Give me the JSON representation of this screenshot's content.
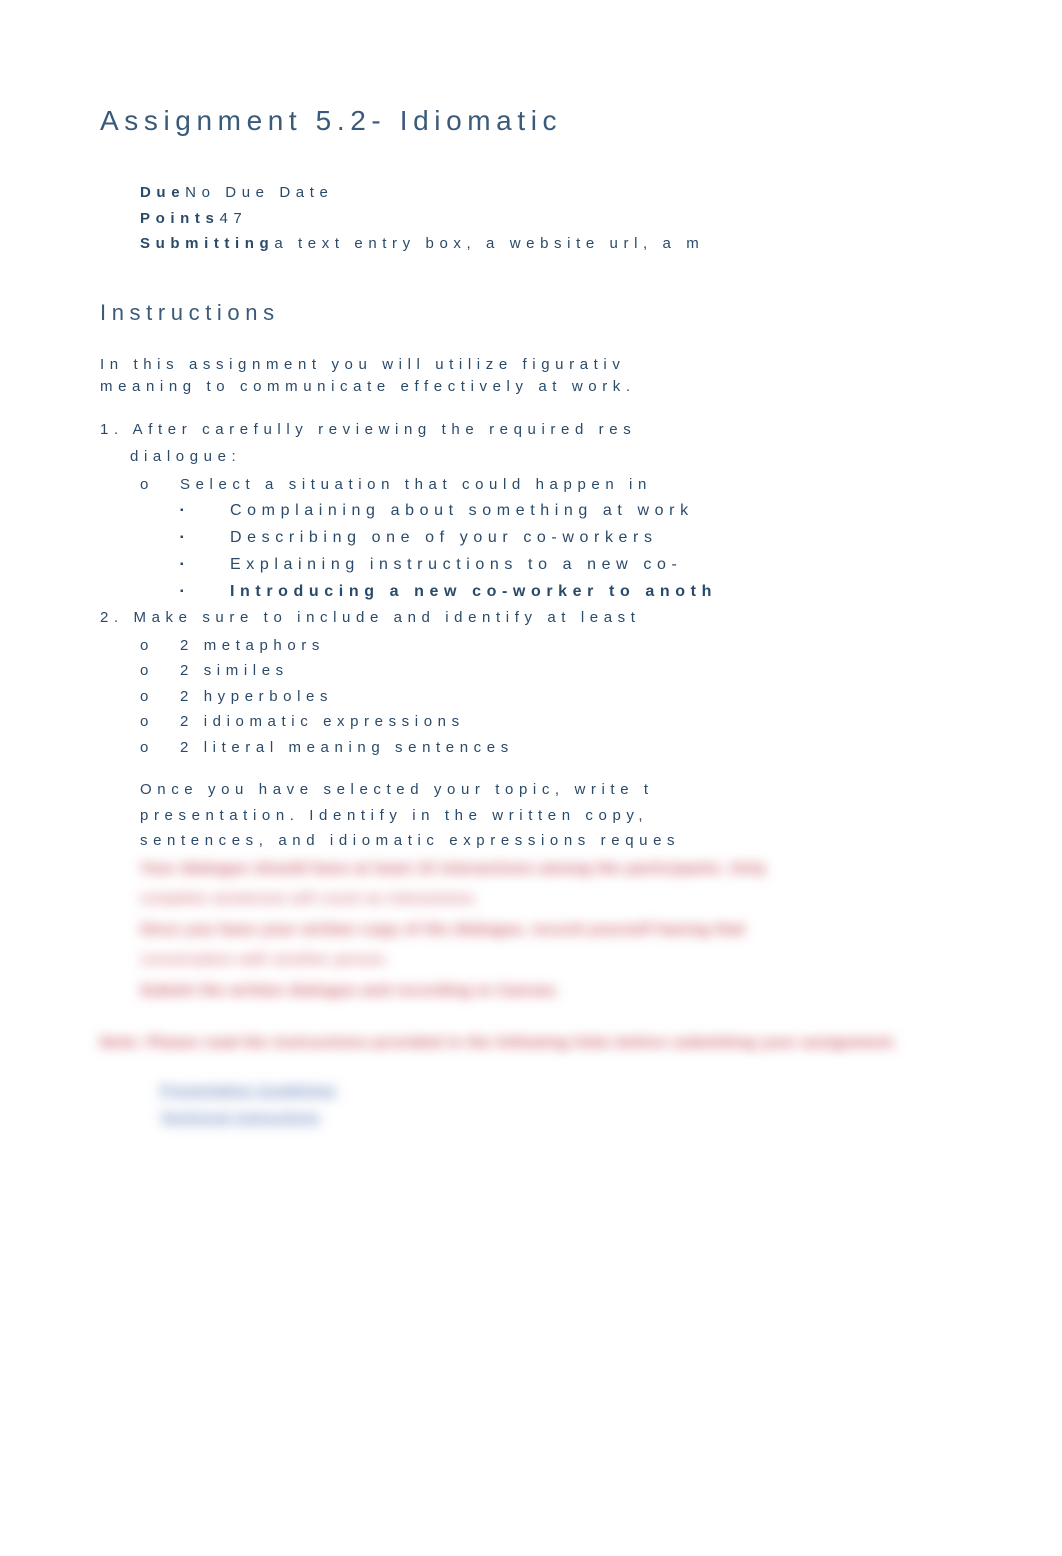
{
  "title": "Assignment 5.2- Idiomatic",
  "meta": {
    "due_label": "Due",
    "due_value": "No Due Date",
    "points_label": "Points",
    "points_value": "47",
    "submit_label": "Submitting",
    "submit_value": "a text entry box, a website url, a m"
  },
  "instructions_heading": "Instructions",
  "intro_line1": "In this assignment you will utilize figurativ",
  "intro_line2": "meaning to communicate effectively at work.",
  "step1": "1. After carefully reviewing the required res",
  "step1_sub": "dialogue:",
  "step1_o": "Select a situation that could happen in",
  "situations": [
    "Complaining about something at work",
    "Describing one of your co-workers",
    "Explaining instructions to a new co-"
  ],
  "situation_bold": "Introducing a new co-worker to anoth",
  "step2": "2. Make sure to include and identify at least",
  "requirements": [
    "2 metaphors",
    "2 similes",
    "2 hyperboles",
    "2 idiomatic expressions",
    "2 literal meaning sentences"
  ],
  "bullet_main": "Once you have selected your topic, write t",
  "bullet_cont1": "presentation. Identify in the written copy,",
  "bullet_cont2": "sentences, and idiomatic expressions reques",
  "blurred": {
    "line1": "Your dialogue should have at least 15 interactions among the participants. Only",
    "line1b": "complete sentences will count as interactions.",
    "line2": "Once you have your written copy of the dialogue, record yourself having that",
    "line2b": "conversation with another person.",
    "line3": "Submit the written dialogue and recording to Canvas."
  },
  "note": "Note: Please read the instructions provided in the following links before submitting your assignment.",
  "links": [
    "Presentation Guidelines",
    "Technical Instructions"
  ]
}
